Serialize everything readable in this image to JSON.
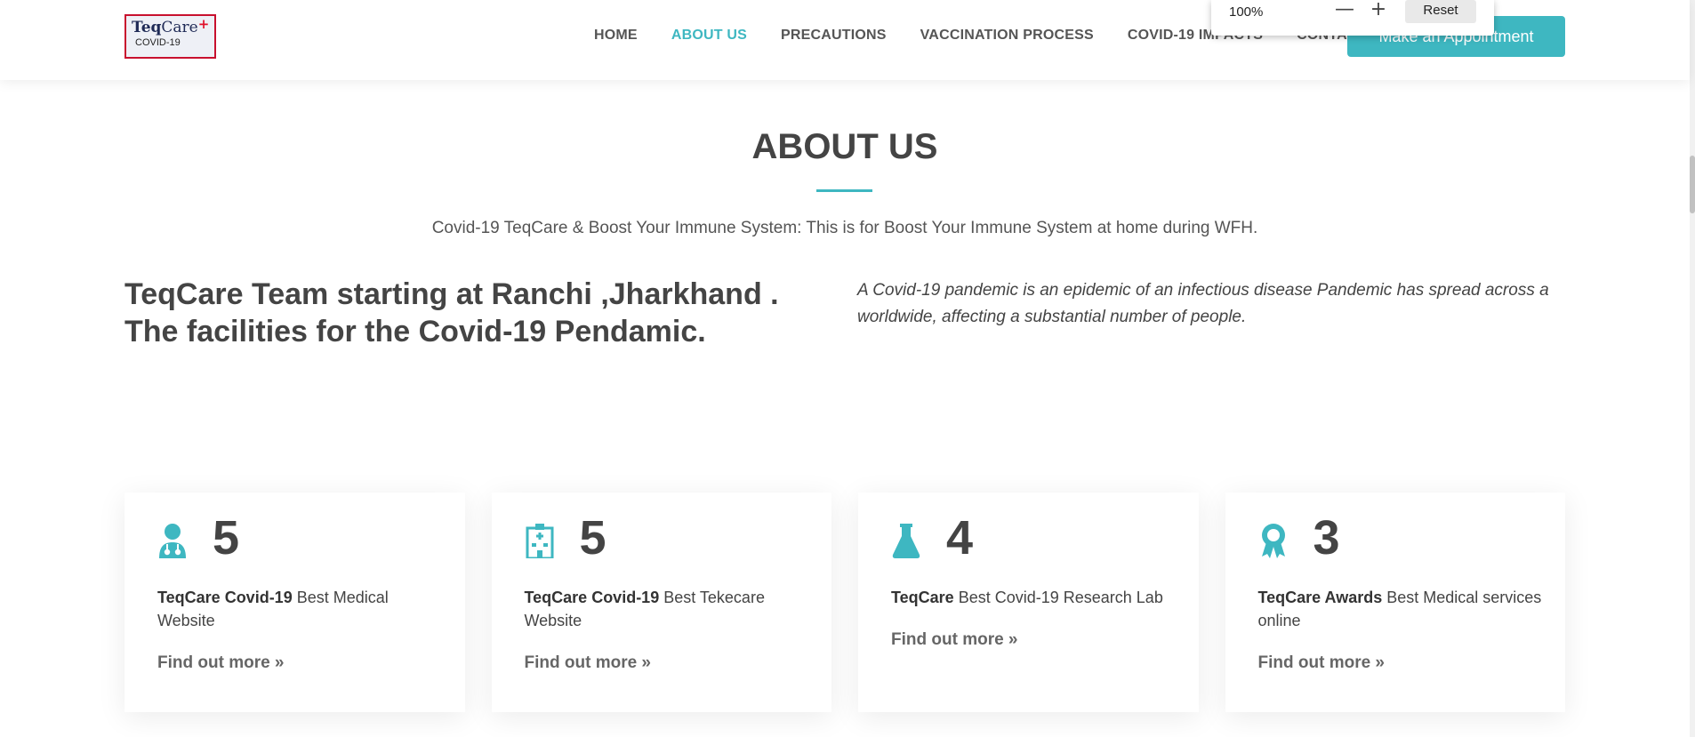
{
  "header": {
    "logo": {
      "brand_teq": "Teq",
      "brand_care": "Care",
      "brand_plus": "+",
      "sub": "COVID-19"
    },
    "nav": [
      "HOME",
      "ABOUT US",
      "PRECAUTIONS",
      "VACCINATION PROCESS",
      "COVID-19 IMPACTS",
      "CONTACT"
    ],
    "active_nav": "ABOUT US",
    "cta_label": "Make an Appointment"
  },
  "zoom_popup": {
    "level": "100%",
    "minus": "—",
    "plus": "+",
    "reset_label": "Reset"
  },
  "about": {
    "title": "ABOUT US",
    "subtitle": "Covid-19 TeqCare & Boost Your Immune System: This is for Boost Your Immune System at home during WFH.",
    "lead_left": "TeqCare Team starting at Ranchi ,Jharkhand . The facilities for the Covid-19 Pendamic.",
    "lead_right": "A Covid-19 pandemic is an epidemic of an infectious disease Pandemic has spread across a worldwide, affecting a substantial number of people."
  },
  "stats": [
    {
      "icon": "doctor-icon",
      "number": "5",
      "bold": "TeqCare Covid-19",
      "text": " Best Medical Website",
      "link": "Find out more »"
    },
    {
      "icon": "hospital-icon",
      "number": "5",
      "bold": "TeqCare Covid-19",
      "text": " Best Tekecare Website",
      "link": "Find out more »"
    },
    {
      "icon": "flask-icon",
      "number": "4",
      "bold": "TeqCare",
      "text": " Best Covid-19 Research Lab",
      "link": "Find out more »"
    },
    {
      "icon": "award-icon",
      "number": "3",
      "bold": "TeqCare Awards",
      "text": " Best Medical services online",
      "link": "Find out more »"
    }
  ],
  "colors": {
    "accent": "#3eb7c1",
    "text": "#444444"
  }
}
